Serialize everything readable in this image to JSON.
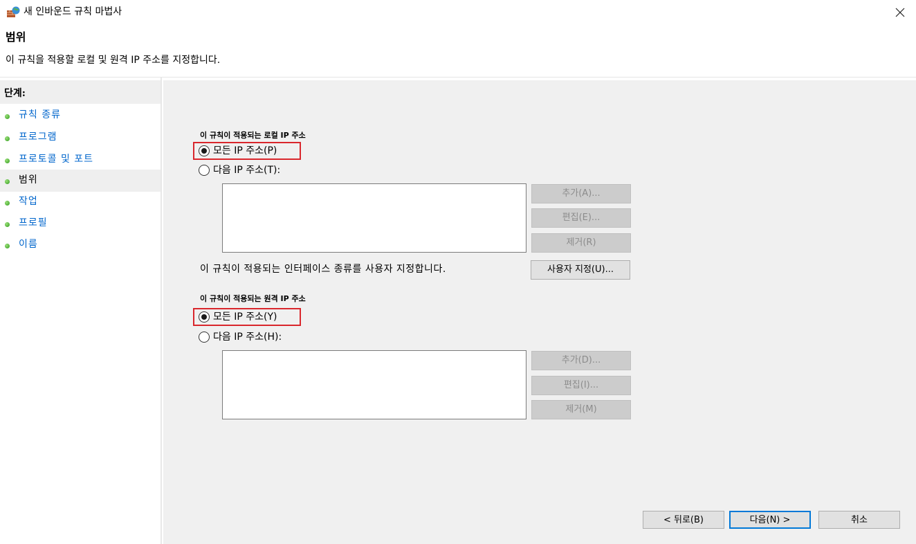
{
  "window": {
    "title": "새 인바운드 규칙 마법사"
  },
  "header": {
    "title": "범위",
    "description": "이 규칙을 적용할 로컬 및 원격 IP 주소를 지정합니다."
  },
  "sidebar": {
    "heading": "단계:",
    "items": [
      {
        "label": "규칙 종류",
        "active": false
      },
      {
        "label": "프로그램",
        "active": false
      },
      {
        "label": "프로토콜 및 포트",
        "active": false
      },
      {
        "label": "범위",
        "active": true
      },
      {
        "label": "작업",
        "active": false
      },
      {
        "label": "프로필",
        "active": false
      },
      {
        "label": "이름",
        "active": false
      }
    ]
  },
  "local": {
    "title": "이 규칙이 적용되는 로컬 IP 주소",
    "any_label": "모든 IP 주소(P)",
    "specific_label": "다음 IP 주소(T):",
    "selected": "any",
    "add_label": "추가(A)...",
    "edit_label": "편집(E)...",
    "remove_label": "제거(R)"
  },
  "interface": {
    "text": "이 규칙이 적용되는 인터페이스 종류를 사용자 지정합니다.",
    "customize_label": "사용자 지정(U)..."
  },
  "remote": {
    "title": "이 규칙이 적용되는 원격 IP 주소",
    "any_label": "모든 IP 주소(Y)",
    "specific_label": "다음 IP 주소(H):",
    "selected": "any",
    "add_label": "추가(D)...",
    "edit_label": "편집(I)...",
    "remove_label": "제거(M)"
  },
  "footer": {
    "back_label": "< 뒤로(B)",
    "next_label": "다음(N) >",
    "cancel_label": "취소"
  },
  "colors": {
    "highlight": "#d9262c",
    "link": "#0066cc",
    "accent": "#0078d7"
  }
}
